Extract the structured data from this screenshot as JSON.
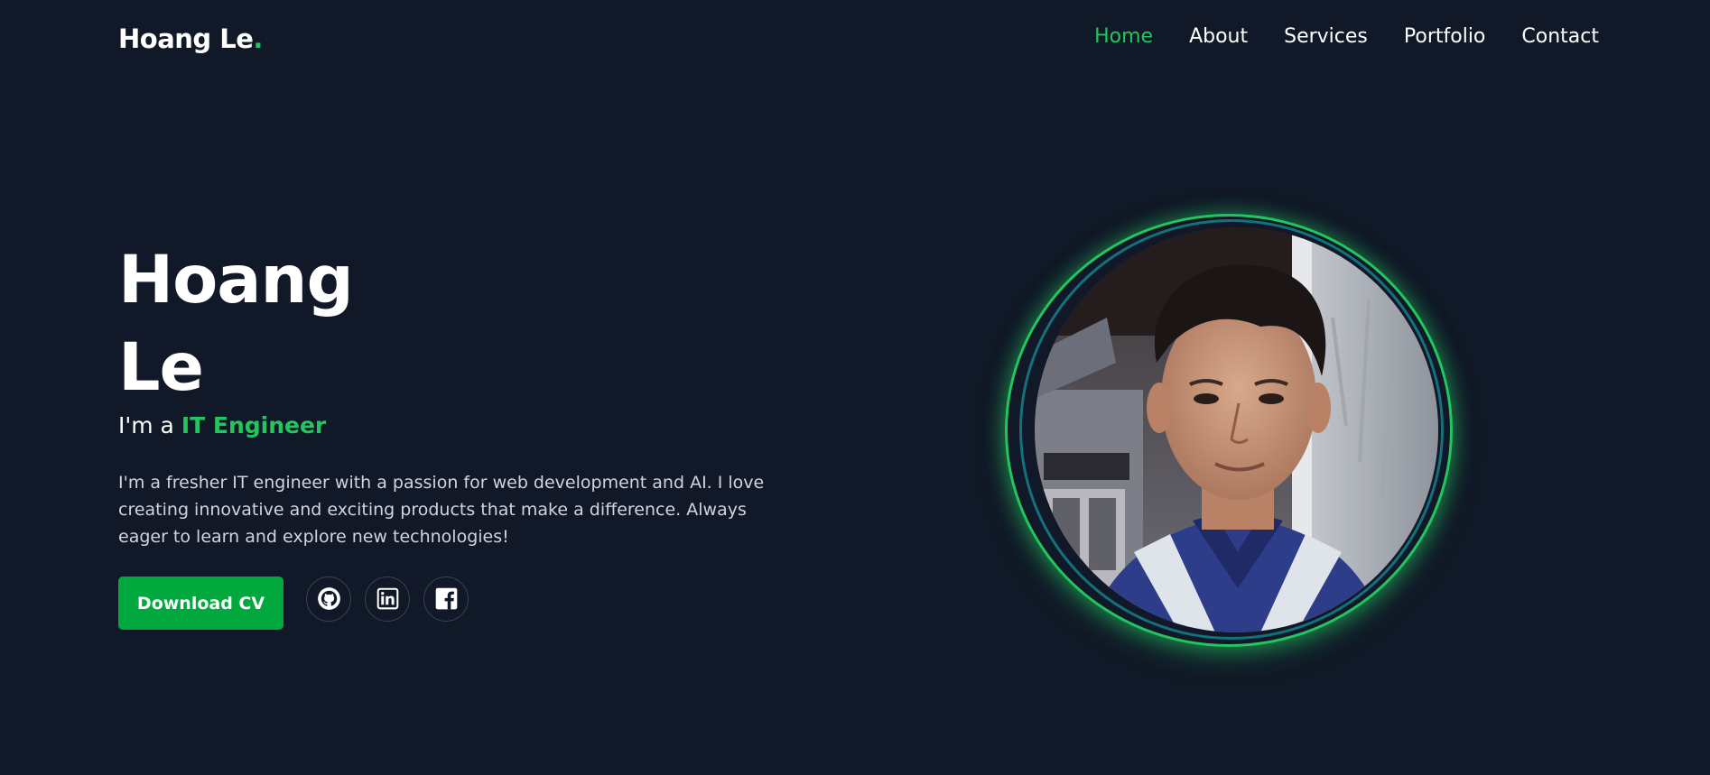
{
  "header": {
    "logo_text": "Hoang Le",
    "logo_dot": ".",
    "nav": [
      {
        "label": "Home",
        "active": true
      },
      {
        "label": "About",
        "active": false
      },
      {
        "label": "Services",
        "active": false
      },
      {
        "label": "Portfolio",
        "active": false
      },
      {
        "label": "Contact",
        "active": false
      }
    ]
  },
  "hero": {
    "name_line1": "Hoang",
    "name_line2": "Le",
    "role_prefix": "I'm a",
    "role": "IT Engineer",
    "description": "I'm a fresher IT engineer with a passion for web development and AI. I love creating innovative and exciting products that make a difference. Always eager to learn and explore new technologies!",
    "cta_label": "Download CV",
    "socials": [
      {
        "icon": "github-icon"
      },
      {
        "icon": "linkedin-icon"
      },
      {
        "icon": "facebook-icon"
      }
    ]
  },
  "colors": {
    "background": "#111827",
    "accent": "#22c55e",
    "button": "#00a83e",
    "text": "#ffffff",
    "muted_text": "#d1d5db"
  }
}
